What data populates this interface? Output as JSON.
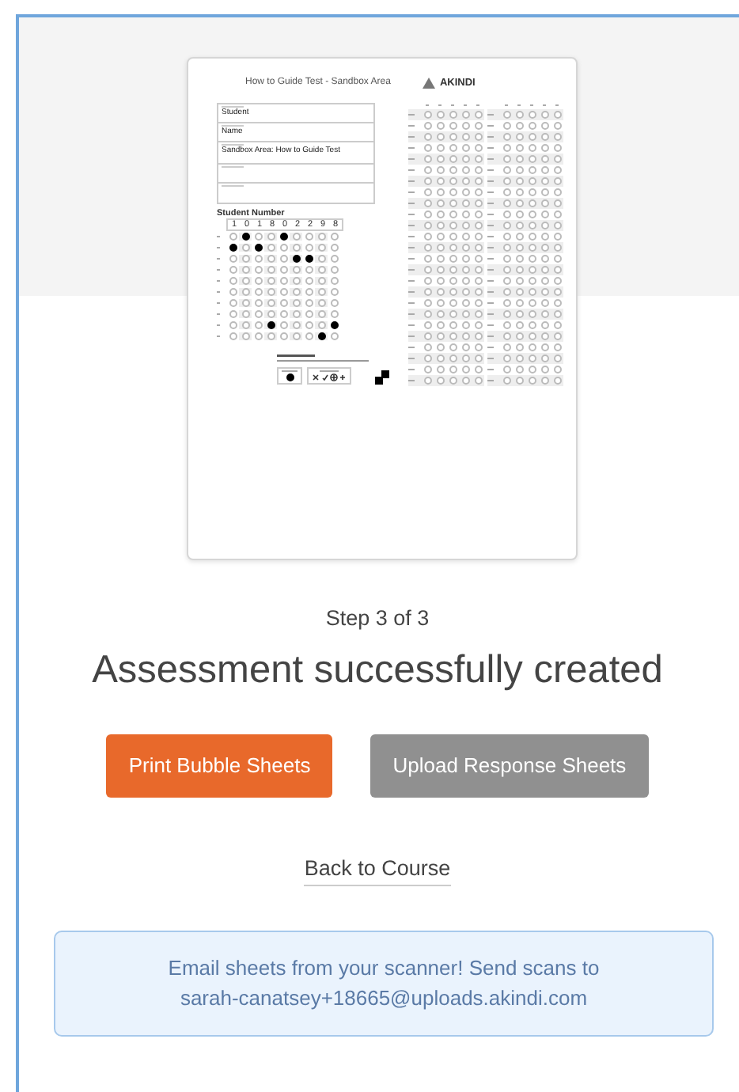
{
  "preview": {
    "title": "How to Guide Test - Sandbox Area",
    "logo": "AKINDI",
    "fields": [
      {
        "kind": "text",
        "value": "Student"
      },
      {
        "kind": "text",
        "value": "Name"
      },
      {
        "kind": "text",
        "value": "Sandbox Area: How to Guide Test"
      },
      {
        "kind": "blank"
      },
      {
        "kind": "blank"
      }
    ],
    "student_number": {
      "heading": "Student Number",
      "digits": [
        "1",
        "0",
        "1",
        "8",
        "0",
        "2",
        "2",
        "9",
        "8"
      ]
    }
  },
  "step": "Step 3 of 3",
  "heading": "Assessment successfully created",
  "buttons": [
    {
      "label": "Print Bubble Sheets",
      "kind": "primary",
      "disabled": false
    },
    {
      "label": "Upload Response Sheets",
      "kind": "secondary",
      "disabled": true
    }
  ],
  "back_link": "Back to Course",
  "notice": {
    "text": "Email sheets from your scanner! Send scans to",
    "email": "sarah-canatsey+18665@uploads.akindi.com"
  }
}
